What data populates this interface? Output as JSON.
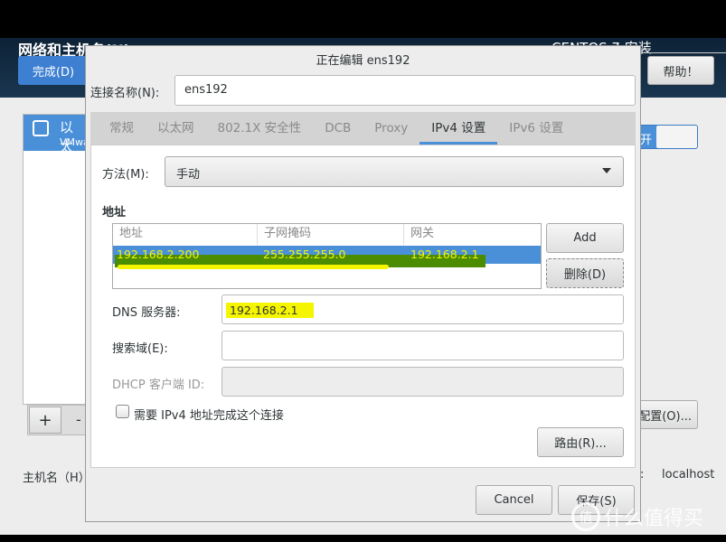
{
  "header": {
    "title": "网络和主机名(N)",
    "product": "CENTOS 7 安装",
    "done_label": "完成(D)",
    "help_label": "帮助！"
  },
  "background": {
    "device_name": "以太",
    "device_sub": "VMwa",
    "add_label": "+",
    "remove_label": "-",
    "toggle_label": "开",
    "configure_label": "配置(O)...",
    "hostname_label": "主机名（H）",
    "hostname_colon": ":",
    "hostname_value": "localhost"
  },
  "dialog": {
    "title": "正在编辑 ens192",
    "connection_name_label": "连接名称(N):",
    "connection_name_value": "ens192",
    "tabs": [
      {
        "label": "常规"
      },
      {
        "label": "以太网"
      },
      {
        "label": "802.1X 安全性"
      },
      {
        "label": "DCB"
      },
      {
        "label": "Proxy"
      },
      {
        "label": "IPv4 设置",
        "active": true
      },
      {
        "label": "IPv6 设置"
      }
    ],
    "method_label": "方法(M):",
    "method_value": "手动",
    "addresses_heading": "地址",
    "table": {
      "columns": [
        "地址",
        "子网掩码",
        "网关"
      ],
      "rows": [
        [
          "192.168.2.200",
          "255.255.255.0",
          "192.168.2.1"
        ]
      ]
    },
    "add_label": "Add",
    "delete_label": "删除(D)",
    "dns_label": "DNS 服务器:",
    "dns_value": "192.168.2.1",
    "search_label": "搜索域(E):",
    "search_value": "",
    "dhcp_label": "DHCP 客户端 ID:",
    "dhcp_value": "",
    "require_ipv4_label": "需要 IPv4 地址完成这个连接",
    "require_ipv4_checked": false,
    "routes_label": "路由(R)...",
    "cancel_label": "Cancel",
    "save_label": "保存(S)"
  },
  "watermark": {
    "logo": "值",
    "text": "什么值得买"
  },
  "colors": {
    "accent": "#4a90d9",
    "highlight_yellow": "#f5f500",
    "highlight_green": "#4c8c00"
  }
}
